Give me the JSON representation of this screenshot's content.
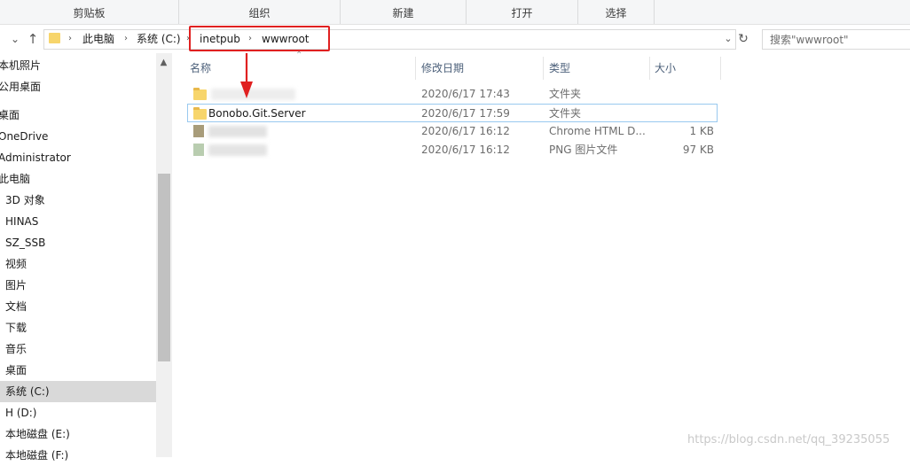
{
  "ribbon": {
    "groups": [
      "剪贴板",
      "组织",
      "新建",
      "打开",
      "选择"
    ]
  },
  "address_bar": {
    "crumbs": [
      "此电脑",
      "系统 (C:)",
      "inetpub",
      "wwwroot"
    ],
    "search_placeholder": "搜索\"wwwroot\""
  },
  "nav_pane": {
    "items": [
      {
        "label": "本机照片"
      },
      {
        "label": "公用桌面"
      },
      {
        "label": "桌面"
      },
      {
        "label": "OneDrive"
      },
      {
        "label": "Administrator"
      },
      {
        "label": "此电脑"
      },
      {
        "label": "3D 对象"
      },
      {
        "label": "HINAS"
      },
      {
        "label": "SZ_SSB"
      },
      {
        "label": "视频"
      },
      {
        "label": "图片"
      },
      {
        "label": "文档"
      },
      {
        "label": "下载"
      },
      {
        "label": "音乐"
      },
      {
        "label": "桌面"
      },
      {
        "label": "系统 (C:)",
        "selected": true
      },
      {
        "label": "H (D:)"
      },
      {
        "label": "本地磁盘 (E:)"
      },
      {
        "label": "本地磁盘 (F:)"
      }
    ]
  },
  "file_list": {
    "columns": [
      "名称",
      "修改日期",
      "类型",
      "大小"
    ],
    "rows": [
      {
        "name": "",
        "date": "2020/6/17 17:43",
        "type": "文件夹",
        "size": "",
        "icon": "folder-icon",
        "blurred": true
      },
      {
        "name": "Bonobo.Git.Server",
        "date": "2020/6/17 17:59",
        "type": "文件夹",
        "size": "",
        "icon": "folder-icon",
        "selected": true
      },
      {
        "name": "",
        "date": "2020/6/17 16:12",
        "type": "Chrome HTML D...",
        "size": "1 KB",
        "icon": "html-file-icon",
        "blurred": true
      },
      {
        "name": "",
        "date": "2020/6/17 16:12",
        "type": "PNG 图片文件",
        "size": "97 KB",
        "icon": "png-file-icon",
        "blurred": true
      }
    ]
  },
  "watermark": "https://blog.csdn.net/qq_39235055",
  "colors": {
    "highlight": "#e02020",
    "selection": "#d9d9d9",
    "row_selected_border": "#99c9ef",
    "folder": "#f7d56b"
  }
}
